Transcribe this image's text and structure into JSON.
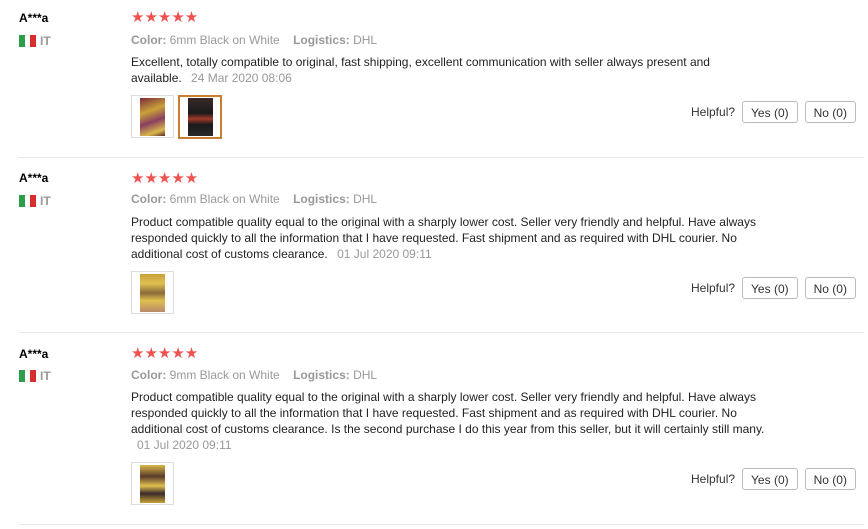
{
  "reviews": [
    {
      "user": "A***a",
      "country": "IT",
      "rating": "★★★★★",
      "color_label": "Color:",
      "color_value": "6mm Black on White",
      "logistics_label": "Logistics:",
      "logistics_value": "DHL",
      "text": "Excellent, totally compatible to original, fast shipping, excellent communication with seller always present and available.",
      "date": "24 Mar 2020 08:06",
      "helpful_label": "Helpful?",
      "yes_label": "Yes (0)",
      "no_label": "No (0)"
    },
    {
      "user": "A***a",
      "country": "IT",
      "rating": "★★★★★",
      "color_label": "Color:",
      "color_value": "6mm Black on White",
      "logistics_label": "Logistics:",
      "logistics_value": "DHL",
      "text": "Product compatible quality equal to the original with a sharply lower cost. Seller very friendly and helpful. Have always responded quickly to all the information that I have requested. Fast shipment and as required with DHL courier. No additional cost of customs clearance.",
      "date": "01 Jul 2020 09:11",
      "helpful_label": "Helpful?",
      "yes_label": "Yes (0)",
      "no_label": "No (0)"
    },
    {
      "user": "A***a",
      "country": "IT",
      "rating": "★★★★★",
      "color_label": "Color:",
      "color_value": "9mm Black on White",
      "logistics_label": "Logistics:",
      "logistics_value": "DHL",
      "text": "Product compatible quality equal to the original with a sharply lower cost. Seller very friendly and helpful. Have always responded quickly to all the information that I have requested. Fast shipment and as required with DHL courier. No additional cost of customs clearance. Is the second purchase I do this year from this seller, but it will certainly still many.",
      "date": "01 Jul 2020 09:11",
      "helpful_label": "Helpful?",
      "yes_label": "Yes (0)",
      "no_label": "No (0)"
    }
  ],
  "colors": {
    "star": "#ef5350",
    "flag_green": "#2e9c48",
    "flag_white": "#ffffff",
    "flag_red": "#d62d2d",
    "thumb_selected_border": "#c97f2e"
  }
}
